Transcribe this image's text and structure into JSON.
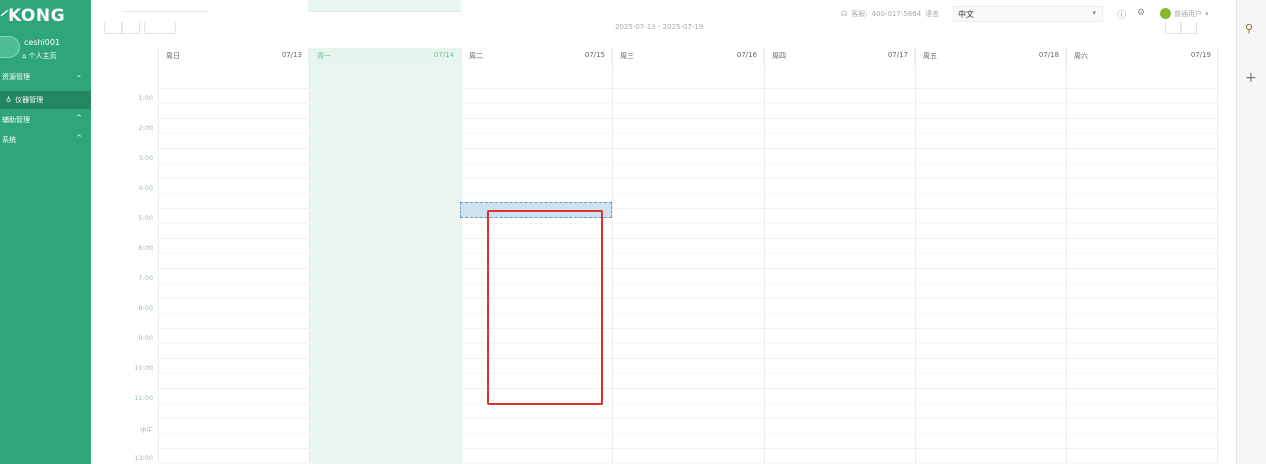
{
  "sidebar": {
    "logo": "KONG",
    "logo_mark": "⸍",
    "user": {
      "name": "ceshi001",
      "home": "个人主页"
    },
    "menu": [
      {
        "label": "资源管理",
        "arrow": "⌄"
      },
      {
        "label": "仪器管理",
        "icon": "♁"
      },
      {
        "label": "辅助管理",
        "arrow": "^"
      },
      {
        "label": "系统",
        "arrow": "^"
      }
    ]
  },
  "topbar": {
    "hotline_label": "客服:",
    "hotline_number": "400-017-5664",
    "lang_label": "语言",
    "lang_value": "中文",
    "user_role": "普通用户"
  },
  "calendar": {
    "range": "2025-07-13 - 2025-07-19",
    "days": [
      {
        "name": "周日",
        "date": "07/13"
      },
      {
        "name": "周一",
        "date": "07/14"
      },
      {
        "name": "周二",
        "date": "07/15"
      },
      {
        "name": "周三",
        "date": "07/16"
      },
      {
        "name": "周四",
        "date": "07/17"
      },
      {
        "name": "周五",
        "date": "07/18"
      },
      {
        "name": "周六",
        "date": "07/19"
      }
    ],
    "times": [
      "1:00",
      "2:00",
      "3:00",
      "4:00",
      "5:00",
      "6:00",
      "7:00",
      "8:00",
      "9:00",
      "10:00",
      "11:00",
      "中午",
      "13:00"
    ]
  },
  "colors": {
    "sidebar": "#2fa57a",
    "today": "#eaf6f0",
    "highlight": "#d9332b",
    "selection": "#cfe2ef"
  }
}
